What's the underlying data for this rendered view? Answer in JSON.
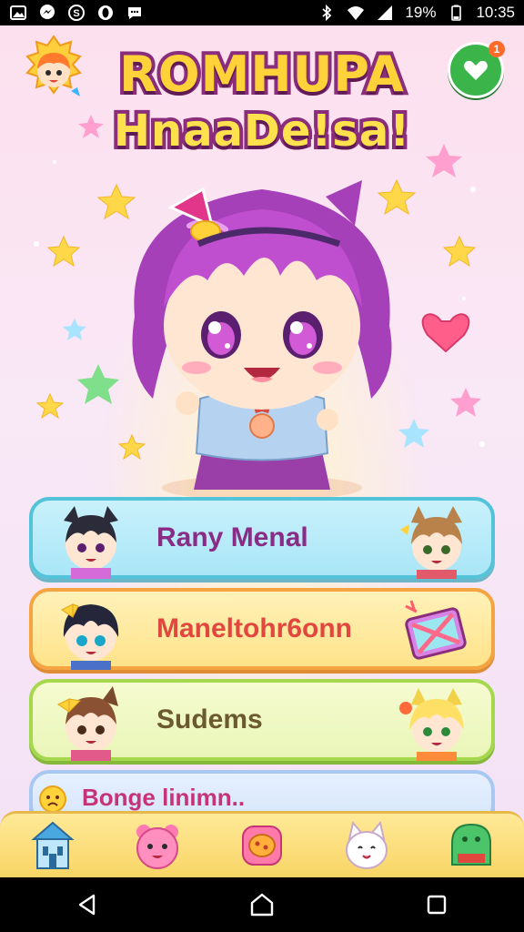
{
  "status_bar": {
    "notification_icons": [
      "photo-icon",
      "messenger-icon",
      "skype-icon",
      "opera-icon",
      "chat-icon"
    ],
    "battery_percent": "19%",
    "time": "10:35"
  },
  "header": {
    "title_line1": "ROMHUPA",
    "title_line2": "HnaaDe!sa!",
    "notification_badge": "1"
  },
  "menu": {
    "items": [
      {
        "label": "Rany Menal"
      },
      {
        "label": "Maneltohr6onn"
      },
      {
        "label": "Sudems"
      },
      {
        "label": "Bonge linimn.."
      }
    ]
  },
  "toolbar": {
    "items": [
      "home-house-icon",
      "pink-bear-icon",
      "food-plate-icon",
      "white-cat-icon",
      "green-shop-icon"
    ]
  },
  "colors": {
    "title_fill": "#ffd23a",
    "title_outline": "#8a2d7a",
    "card1_bg": "#a9e6f7",
    "card2_bg": "#ffe38a",
    "card3_bg": "#e9f6b8",
    "card4_bg": "#d6e6fb",
    "toolbar_bg": "#f8d565"
  }
}
